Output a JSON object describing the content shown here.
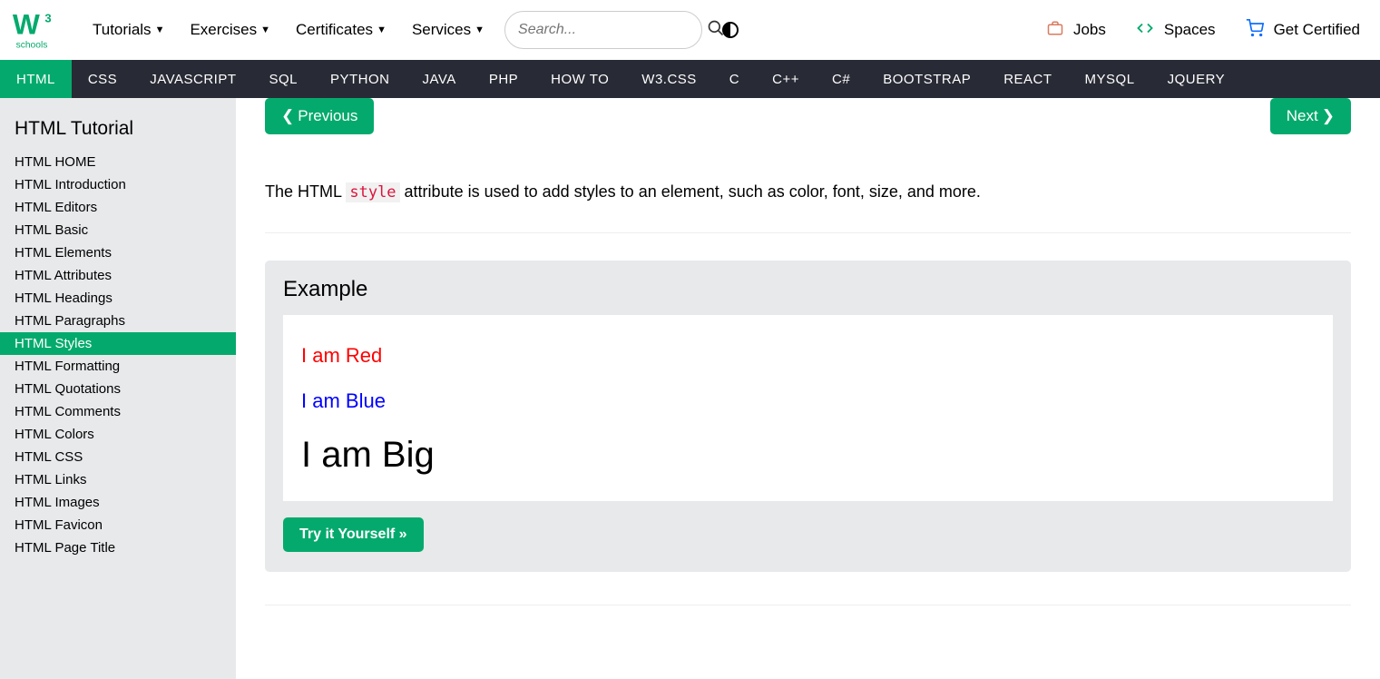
{
  "brand": "schools",
  "topnav": [
    "Tutorials",
    "Exercises",
    "Certificates",
    "Services"
  ],
  "search": {
    "placeholder": "Search..."
  },
  "rightlinks": [
    {
      "icon": "briefcase",
      "label": "Jobs"
    },
    {
      "icon": "code",
      "label": "Spaces"
    },
    {
      "icon": "cart",
      "label": "Get Certified"
    }
  ],
  "langnav": [
    "HTML",
    "CSS",
    "JAVASCRIPT",
    "SQL",
    "PYTHON",
    "JAVA",
    "PHP",
    "HOW TO",
    "W3.CSS",
    "C",
    "C++",
    "C#",
    "BOOTSTRAP",
    "REACT",
    "MYSQL",
    "JQUERY"
  ],
  "langnav_active": "HTML",
  "sidebar": {
    "title": "HTML Tutorial",
    "items": [
      "HTML HOME",
      "HTML Introduction",
      "HTML Editors",
      "HTML Basic",
      "HTML Elements",
      "HTML Attributes",
      "HTML Headings",
      "HTML Paragraphs",
      "HTML Styles",
      "HTML Formatting",
      "HTML Quotations",
      "HTML Comments",
      "HTML Colors",
      "HTML CSS",
      "HTML Links",
      "HTML Images",
      "HTML Favicon",
      "HTML Page Title"
    ],
    "active": "HTML Styles"
  },
  "nav": {
    "prev": "Previous",
    "next": "Next"
  },
  "intro": {
    "before": "The HTML ",
    "code": "style",
    "after": " attribute is used to add styles to an element, such as color, font, size, and more."
  },
  "example": {
    "title": "Example",
    "red": "I am Red",
    "blue": "I am Blue",
    "big": "I am Big",
    "try": "Try it Yourself »"
  }
}
